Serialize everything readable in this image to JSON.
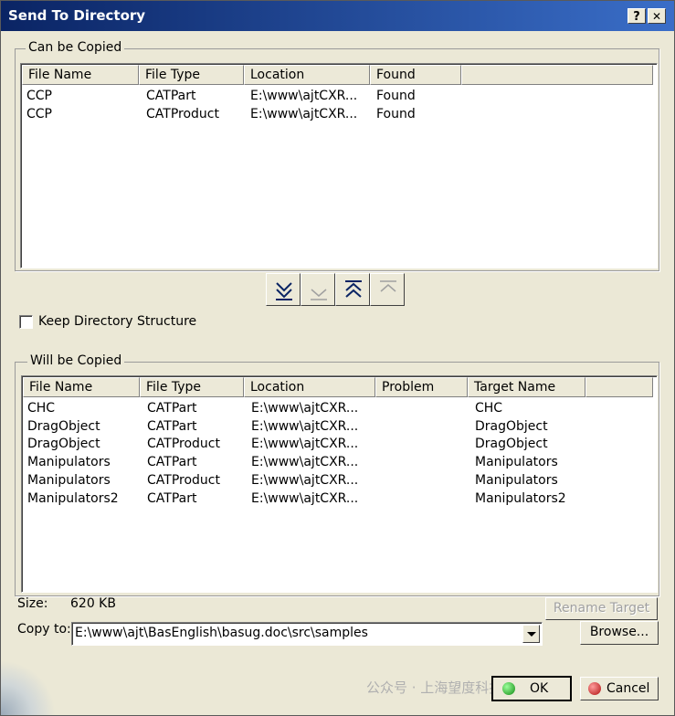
{
  "window": {
    "title": "Send To Directory",
    "help_label": "?",
    "close_label": "✕"
  },
  "can_be_copied": {
    "group_label": "Can be Copied",
    "columns": [
      "File Name",
      "File Type",
      "Location",
      "Found"
    ],
    "rows": [
      [
        "CCP",
        "CATPart",
        "E:\\www\\ajtCXR...",
        "Found"
      ],
      [
        "CCP",
        "CATProduct",
        "E:\\www\\ajtCXR...",
        "Found"
      ]
    ]
  },
  "transfer_buttons": {
    "icons": [
      "double-chevron-down-icon",
      "chevron-down-icon",
      "double-chevron-up-icon",
      "chevron-up-icon"
    ]
  },
  "keep_structure": {
    "label": "Keep Directory Structure",
    "checked": false
  },
  "will_be_copied": {
    "group_label": "Will be Copied",
    "columns": [
      "File Name",
      "File Type",
      "Location",
      "Problem",
      "Target Name"
    ],
    "rows": [
      [
        "CHC",
        "CATPart",
        "E:\\www\\ajtCXR...",
        "",
        "CHC"
      ],
      [
        "DragObject",
        "CATPart",
        "E:\\www\\ajtCXR...",
        "",
        "DragObject"
      ],
      [
        "DragObject",
        "CATProduct",
        "E:\\www\\ajtCXR...",
        "",
        "DragObject"
      ],
      [
        "Manipulators",
        "CATPart",
        "E:\\www\\ajtCXR...",
        "",
        "Manipulators"
      ],
      [
        "Manipulators",
        "CATProduct",
        "E:\\www\\ajtCXR...",
        "",
        "Manipulators"
      ],
      [
        "Manipulators2",
        "CATPart",
        "E:\\www\\ajtCXR...",
        "",
        "Manipulators2"
      ]
    ]
  },
  "size": {
    "label": "Size:",
    "value": "620 KB"
  },
  "rename_target_label": "Rename Target",
  "copy_to": {
    "label": "Copy to:",
    "value": "E:\\www\\ajt\\BasEnglish\\basug.doc\\src\\samples"
  },
  "browse_label": "Browse...",
  "ok_label": "OK",
  "cancel_label": "Cancel",
  "watermark": "公众号 · 上海望度科技有限",
  "colors": {
    "title_start": "#0a2464",
    "title_end": "#3a6ec8",
    "dialog_bg": "#ebe8d6"
  }
}
